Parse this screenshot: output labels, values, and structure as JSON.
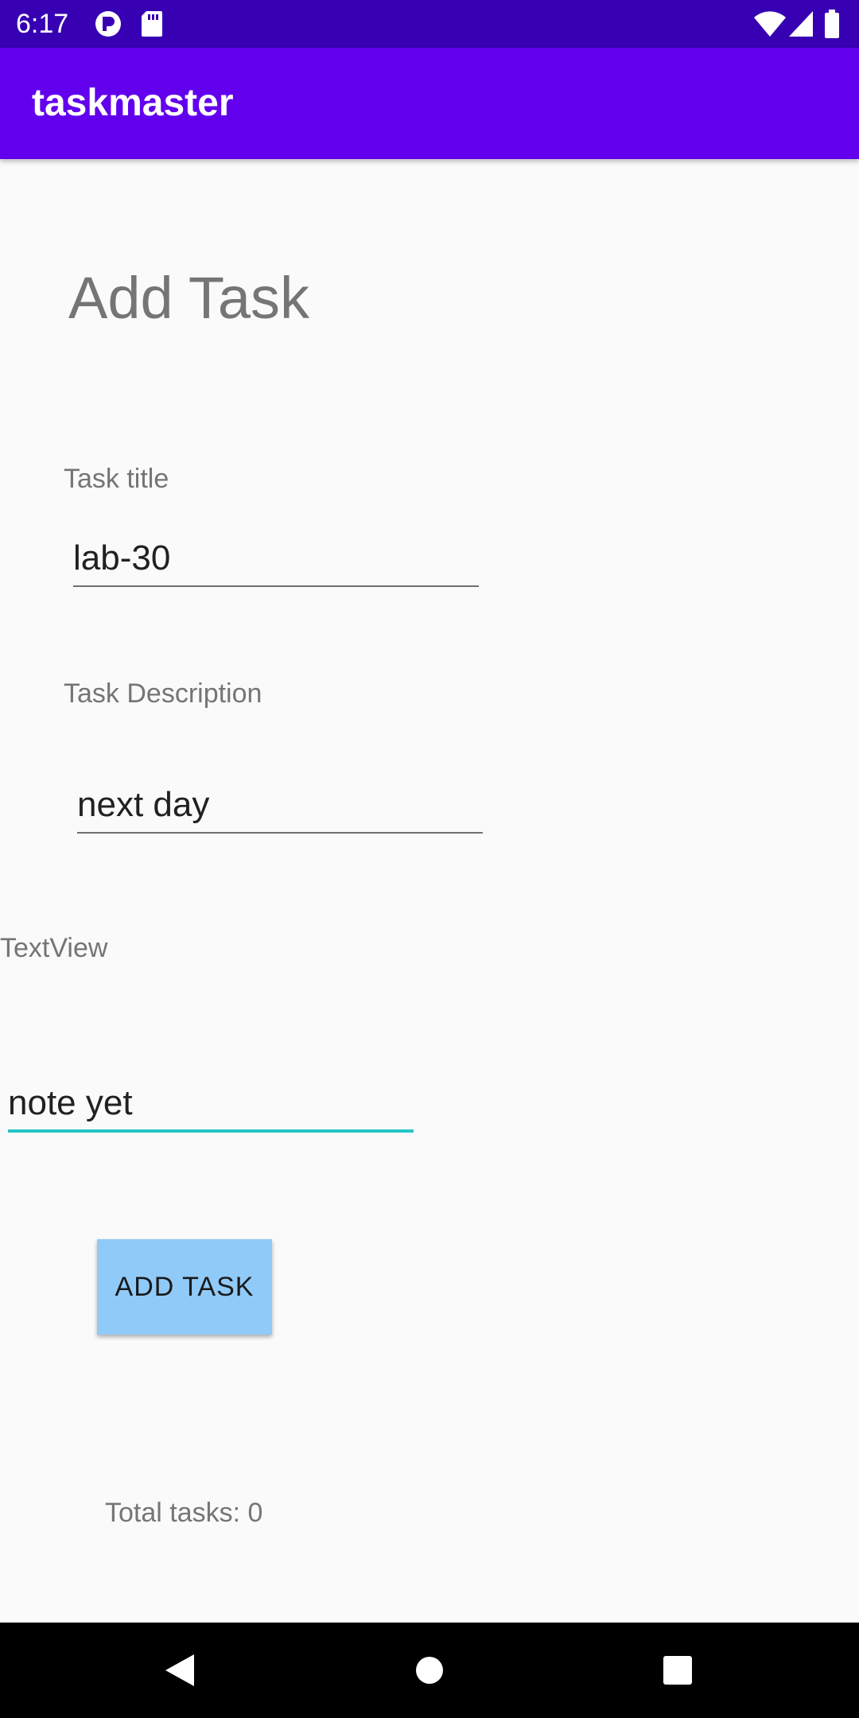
{
  "status_bar": {
    "time": "6:17",
    "icons": [
      "notification-icon",
      "sd-card-icon",
      "wifi-icon",
      "signal-icon",
      "battery-icon"
    ]
  },
  "app_bar": {
    "title": "taskmaster",
    "color": "#6200ee",
    "status_color": "#3700b3"
  },
  "form": {
    "heading": "Add Task",
    "title_label": "Task title",
    "title_value": "lab-30",
    "description_label": "Task Description",
    "description_value": "next day",
    "extra_label": "TextView",
    "extra_value": "note yet",
    "accent_color": "#26c6c6"
  },
  "actions": {
    "add_label": "ADD TASK",
    "button_color": "#90caf9"
  },
  "footer": {
    "total_tasks": "Total tasks: 0"
  },
  "nav_bar": {
    "icons": [
      "back-icon",
      "home-icon",
      "recents-icon"
    ]
  }
}
